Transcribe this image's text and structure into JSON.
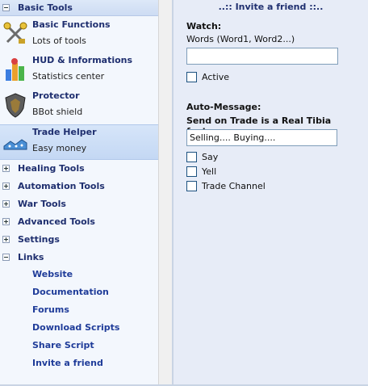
{
  "sidebar": {
    "sections_top": {
      "basic_tools": "Basic Tools"
    },
    "tools": [
      {
        "title": "Basic Functions",
        "sub": "Lots of tools",
        "icon": "tools-icon"
      },
      {
        "title": "HUD & Informations",
        "sub": "Statistics center",
        "icon": "stats-icon"
      },
      {
        "title": "Protector",
        "sub": "BBot shield",
        "icon": "shield-icon"
      },
      {
        "title": "Trade Helper",
        "sub": "Easy money",
        "icon": "trade-icon"
      }
    ],
    "sections": [
      {
        "label": "Healing Tools"
      },
      {
        "label": "Automation Tools"
      },
      {
        "label": "War Tools"
      },
      {
        "label": "Advanced Tools"
      },
      {
        "label": "Settings"
      },
      {
        "label": "Links"
      }
    ],
    "links": [
      "Website",
      "Documentation",
      "Forums",
      "Download Scripts",
      "Share Script",
      "Invite a friend"
    ]
  },
  "panel": {
    "title": "..:: Invite a friend ::..",
    "watch_label": "Watch:",
    "words_label": "Words (Word1, Word2...)",
    "words_value": "",
    "active_label": "Active",
    "auto_message_label": "Auto-Message:",
    "send_on_trade_label": "Send on Trade is a Real Tibia feature",
    "message_value": "Selling.... Buying....",
    "say_label": "Say",
    "yell_label": "Yell",
    "trade_channel_label": "Trade Channel"
  }
}
